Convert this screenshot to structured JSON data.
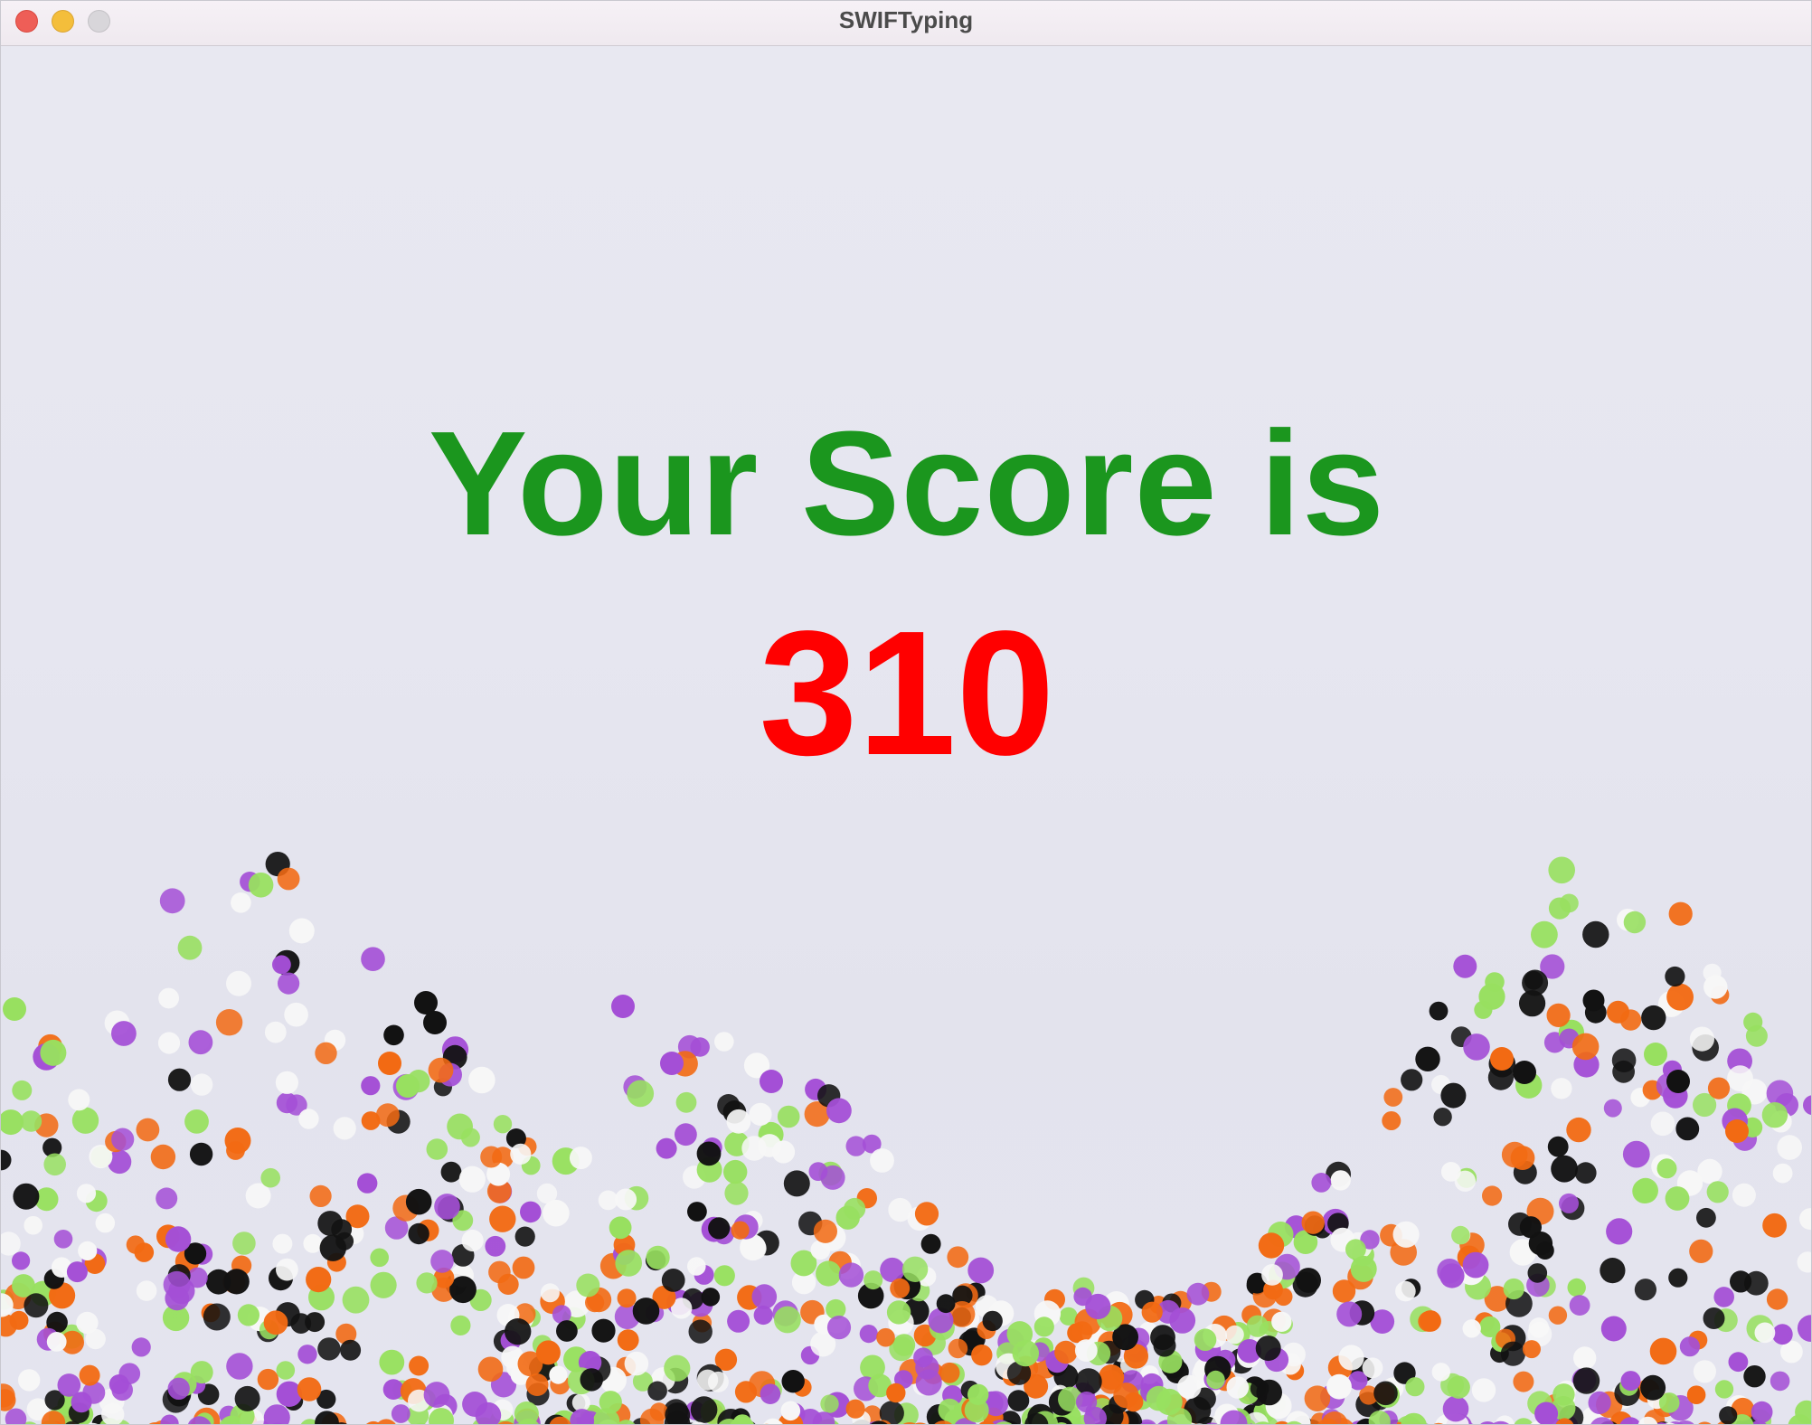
{
  "window": {
    "title": "SWIFTyping"
  },
  "result": {
    "heading": "Your Score is",
    "score": "310"
  },
  "colors": {
    "heading": "#1b961e",
    "score": "#ff0000",
    "confetti": [
      "#f26a13",
      "#121212",
      "#a44fd6",
      "#98e060",
      "#f7f7f7"
    ]
  }
}
